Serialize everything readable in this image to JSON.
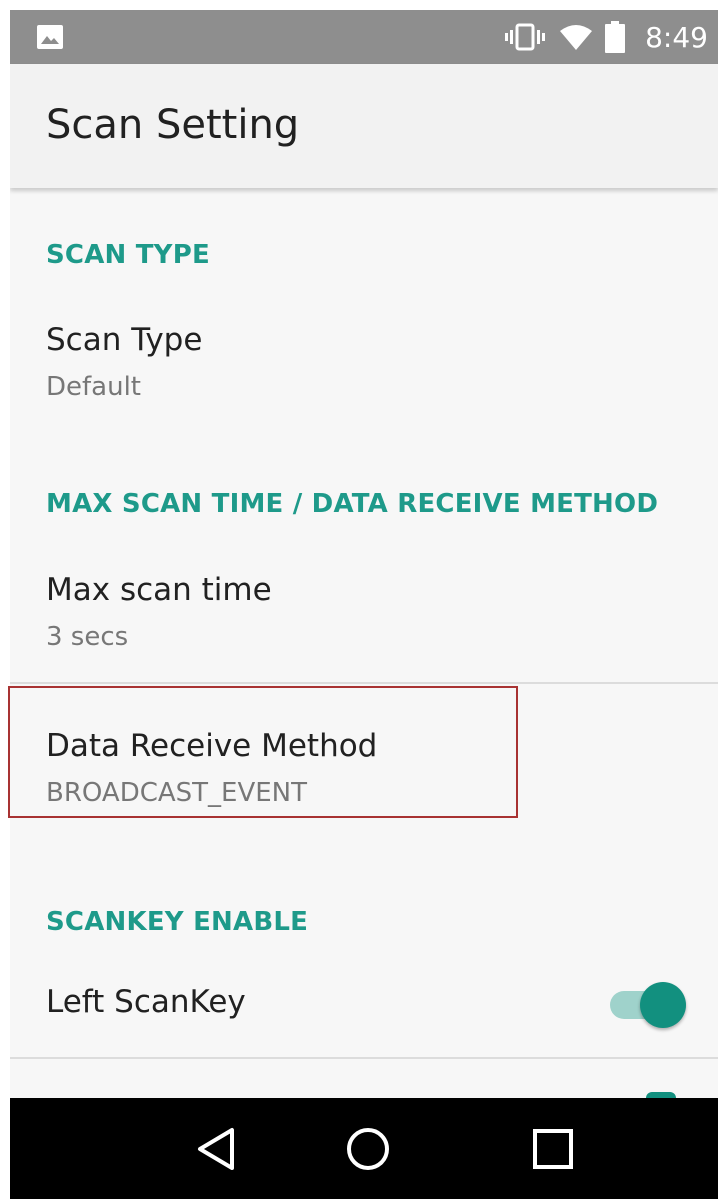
{
  "status_bar": {
    "time": "8:49",
    "icons": [
      "gallery-icon",
      "vibrate-icon",
      "wifi-icon",
      "battery-icon"
    ]
  },
  "app_bar": {
    "title": "Scan Setting"
  },
  "sections": {
    "scan_type_header": "SCAN TYPE",
    "max_scan_header": "MAX SCAN TIME / DATA RECEIVE METHOD",
    "scankey_header": "SCANKEY ENABLE"
  },
  "prefs": {
    "scan_type": {
      "title": "Scan Type",
      "summary": "Default"
    },
    "max_scan_time": {
      "title": "Max scan time",
      "summary": "3 secs"
    },
    "data_receive_method": {
      "title": "Data Receive Method",
      "summary": "BROADCAST_EVENT"
    },
    "left_scankey": {
      "title": "Left ScanKey",
      "enabled": true
    }
  },
  "nav_bar": {
    "icons": [
      "back-icon",
      "home-icon",
      "recents-icon"
    ]
  },
  "colors": {
    "accent": "#1e9a8a",
    "switch_thumb": "#12907f",
    "switch_track": "#9fd2cb",
    "highlight_border": "#a83232",
    "status_bar": "#8e8e8e"
  }
}
